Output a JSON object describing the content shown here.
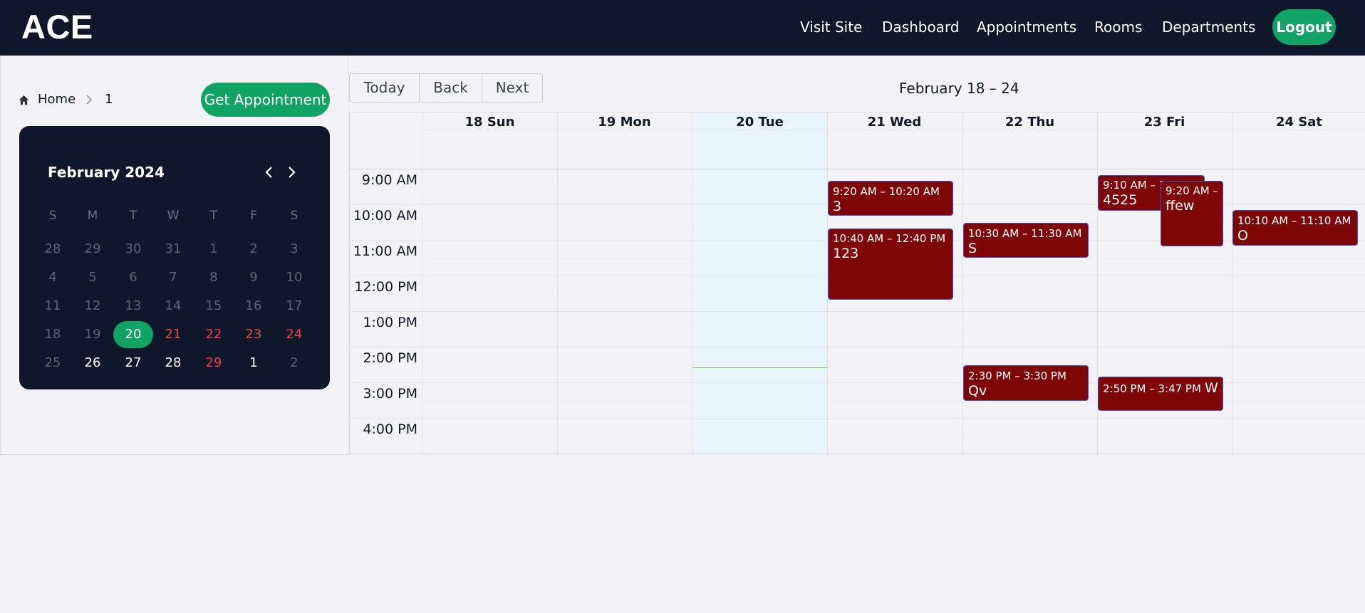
{
  "navbar": {
    "brand": "ACE",
    "links": [
      "Visit Site",
      "Dashboard",
      "Appointments",
      "Rooms",
      "Departments"
    ],
    "logout": "Logout"
  },
  "breadcrumb": {
    "home": "Home",
    "current": "1"
  },
  "get_appointment": "Get Appointment",
  "mini_calendar": {
    "title": "February 2024",
    "weekdays": [
      "S",
      "M",
      "T",
      "W",
      "T",
      "F",
      "S"
    ],
    "weeks": [
      [
        "28",
        "29",
        "30",
        "31",
        "1",
        "2",
        "3"
      ],
      [
        "4",
        "5",
        "6",
        "7",
        "8",
        "9",
        "10"
      ],
      [
        "11",
        "12",
        "13",
        "14",
        "15",
        "16",
        "17"
      ],
      [
        "18",
        "19",
        "20",
        "21",
        "22",
        "23",
        "24"
      ],
      [
        "25",
        "26",
        "27",
        "28",
        "29",
        "1",
        "2"
      ]
    ],
    "selected": "20"
  },
  "toolbar": {
    "today": "Today",
    "back": "Back",
    "next": "Next"
  },
  "range_label": "February 18 – 24",
  "day_headers": [
    "18 Sun",
    "19 Mon",
    "20 Tue",
    "21 Wed",
    "22 Thu",
    "23 Fri",
    "24 Sat"
  ],
  "time_slots": [
    "9:00 AM",
    "10:00 AM",
    "11:00 AM",
    "12:00 PM",
    "1:00 PM",
    "2:00 PM",
    "3:00 PM",
    "4:00 PM"
  ],
  "events": [
    {
      "time": "9:20 AM – 10:20 AM",
      "title": "3"
    },
    {
      "time": "10:40 AM – 12:40 PM",
      "title": "123"
    },
    {
      "time": "10:30 AM – 11:30 AM",
      "title": "S"
    },
    {
      "time": "2:30 PM – 3:30 PM",
      "title": "Qv"
    },
    {
      "time": "9:10 AM – 1",
      "title": "4525"
    },
    {
      "time": "9:20 AM –",
      "title": "ffew"
    },
    {
      "time": "2:50 PM – 3:47 PM",
      "title": "W"
    },
    {
      "time": "10:10 AM – 11:10 AM",
      "title": "O"
    }
  ],
  "colors": {
    "navbar": "#0f172a",
    "accent": "#10a364",
    "event": "#7f0606",
    "today_column": "#e8f5fd",
    "weekend_red": "#ef4444"
  }
}
